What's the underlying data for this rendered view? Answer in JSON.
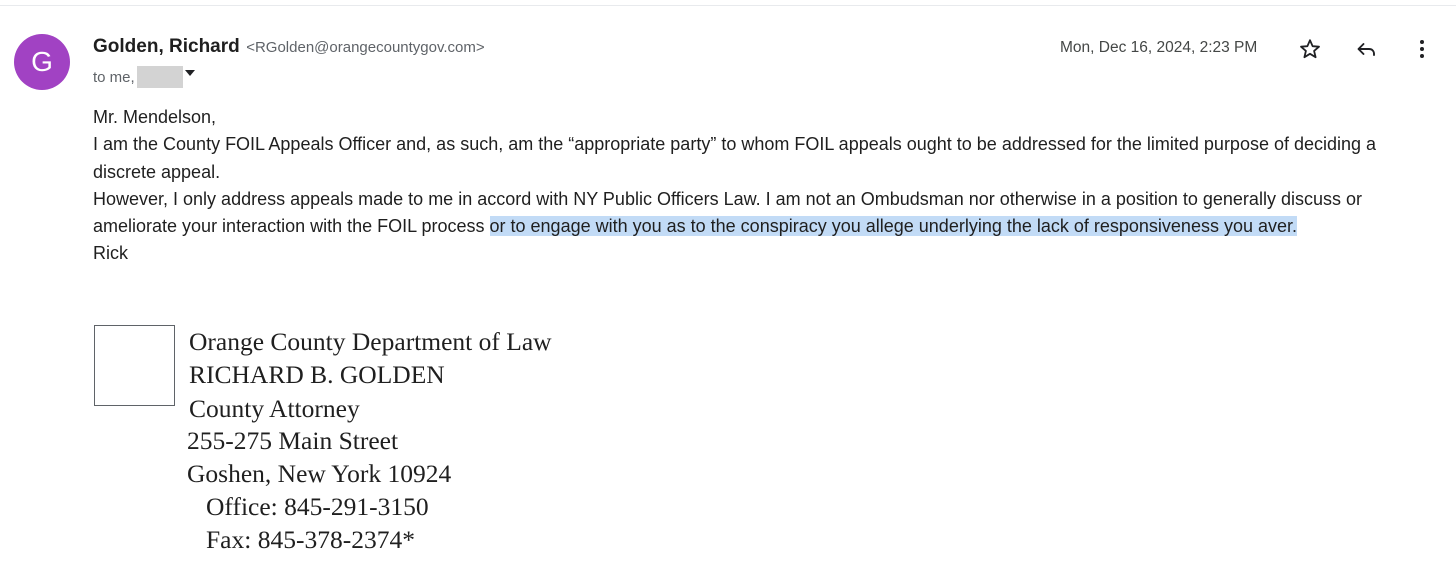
{
  "header": {
    "avatar_letter": "G",
    "avatar_color": "#a142c3",
    "sender_name": "Golden, Richard",
    "sender_email": "<RGolden@orangecountygov.com>",
    "recipients_prefix": "to me,",
    "timestamp": "Mon, Dec 16, 2024, 2:23 PM",
    "icons": [
      "star-icon",
      "reply-icon",
      "more-vert-icon"
    ]
  },
  "body": {
    "salutation": "Mr. Mendelson,",
    "para1": "I am the County FOIL Appeals Officer and, as such, am the “appropriate party” to whom FOIL appeals ought to be addressed for the limited purpose of deciding a discrete appeal.",
    "para2_plain": "However, I only address appeals made to me in accord with NY Public Officers Law. I am not an Ombudsman nor otherwise in a position to generally discuss or ameliorate your interaction with the FOIL process ",
    "para2_highlighted": "or to engage with you as to the conspiracy you allege underlying the lack of responsiveness you aver. ",
    "signoff": "Rick",
    "highlight_color": "#c2dbf6"
  },
  "signature": {
    "org": "Orange County Department of Law",
    "name": "RICHARD B. GOLDEN",
    "title": "County Attorney",
    "street": "255-275 Main Street",
    "city": "Goshen, New York 10924",
    "office": "Office: 845-291-3150",
    "fax": "Fax: 845-378-2374*"
  }
}
